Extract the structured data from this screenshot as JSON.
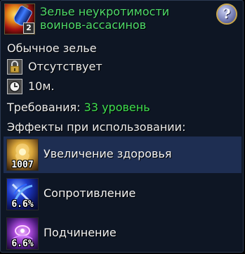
{
  "item": {
    "title": "Зелье неукротимости воинов-ассасинов",
    "stack_count": "2",
    "help_label": "?",
    "rarity": "Обычное зелье",
    "binding": "Отсутствует",
    "duration": "10м.",
    "requirements_label": "Требования:",
    "requirements_value": "33 уровень",
    "effects_header": "Эффекты при использовании:"
  },
  "effects": [
    {
      "label": "Увеличение здоровья",
      "value": "1007",
      "icon": "health-effect-icon",
      "highlighted": true
    },
    {
      "label": "Сопротивление",
      "value": "6.6%",
      "icon": "resistance-effect-icon",
      "highlighted": false
    },
    {
      "label": "Подчинение",
      "value": "6.6%",
      "icon": "submission-effect-icon",
      "highlighted": false
    }
  ],
  "colors": {
    "title": "#4fdc6a",
    "requirement": "#3fe04f",
    "background": "#0e1624",
    "highlight_row": "#1e2e52"
  },
  "icons": {
    "item": "potion-icon",
    "help": "question-mark-icon",
    "binding": "padlock-icon",
    "duration": "clock-icon"
  }
}
